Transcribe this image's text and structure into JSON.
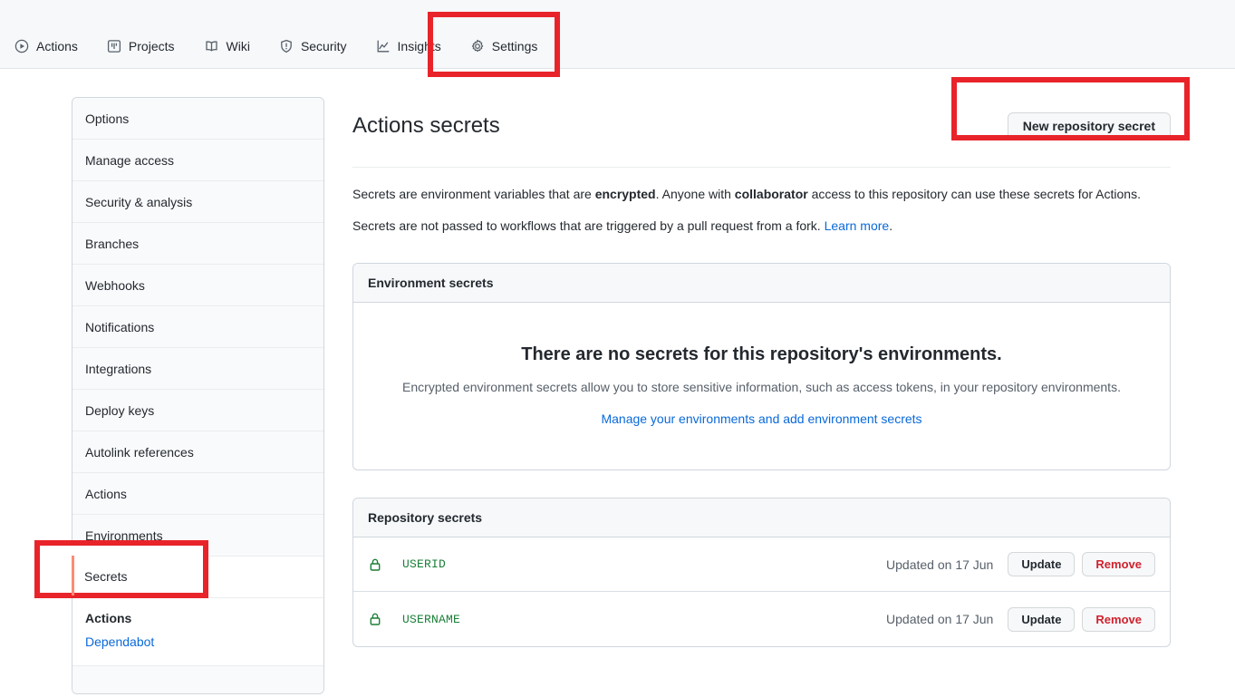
{
  "repo_nav": {
    "items": [
      {
        "label": "Actions",
        "icon": "play-circle-icon",
        "active": false
      },
      {
        "label": "Projects",
        "icon": "project-board-icon",
        "active": false
      },
      {
        "label": "Wiki",
        "icon": "book-icon",
        "active": false
      },
      {
        "label": "Security",
        "icon": "shield-alert-icon",
        "active": false
      },
      {
        "label": "Insights",
        "icon": "graph-icon",
        "active": false
      },
      {
        "label": "Settings",
        "icon": "gear-icon",
        "active": true
      }
    ]
  },
  "sidebar": {
    "items": [
      {
        "label": "Options",
        "state": "normal"
      },
      {
        "label": "Manage access",
        "state": "normal"
      },
      {
        "label": "Security & analysis",
        "state": "normal"
      },
      {
        "label": "Branches",
        "state": "normal"
      },
      {
        "label": "Webhooks",
        "state": "normal"
      },
      {
        "label": "Notifications",
        "state": "normal"
      },
      {
        "label": "Integrations",
        "state": "normal"
      },
      {
        "label": "Deploy keys",
        "state": "normal"
      },
      {
        "label": "Autolink references",
        "state": "normal"
      },
      {
        "label": "Actions",
        "state": "normal"
      },
      {
        "label": "Environments",
        "state": "normal"
      },
      {
        "label": "Secrets",
        "state": "selected"
      }
    ],
    "sub_section": {
      "title": "Actions",
      "link": "Dependabot"
    }
  },
  "main": {
    "title": "Actions secrets",
    "new_secret_button": "New repository secret",
    "description_line1": {
      "part1": "Secrets are environment variables that are ",
      "bold1": "encrypted",
      "part2": ". Anyone with ",
      "bold2": "collaborator",
      "part3": " access to this repository can use these secrets for Actions."
    },
    "description_line2": {
      "text": "Secrets are not passed to workflows that are triggered by a pull request from a fork. ",
      "link": "Learn more",
      "tail": "."
    },
    "environment_card": {
      "header": "Environment secrets",
      "blank_title": "There are no secrets for this repository's environments.",
      "blank_subtitle": "Encrypted environment secrets allow you to store sensitive information, such as access tokens, in your repository environments.",
      "blank_link": "Manage your environments and add environment secrets"
    },
    "repository_card": {
      "header": "Repository secrets",
      "column_update_label": "Update",
      "column_remove_label": "Remove",
      "rows": [
        {
          "icon": "lock-icon",
          "name": "USERID",
          "updated": "Updated on 17 Jun",
          "update": "Update",
          "remove": "Remove"
        },
        {
          "icon": "lock-icon",
          "name": "USERNAME",
          "updated": "Updated on 17 Jun",
          "update": "Update",
          "remove": "Remove"
        }
      ]
    }
  },
  "annotations": {
    "color": "#e8242a",
    "boxes": [
      {
        "target": "settings-tab"
      },
      {
        "target": "new-repository-secret-button"
      },
      {
        "target": "sidebar-item-secrets"
      }
    ],
    "secrets_overlay_label": "Secrets"
  }
}
